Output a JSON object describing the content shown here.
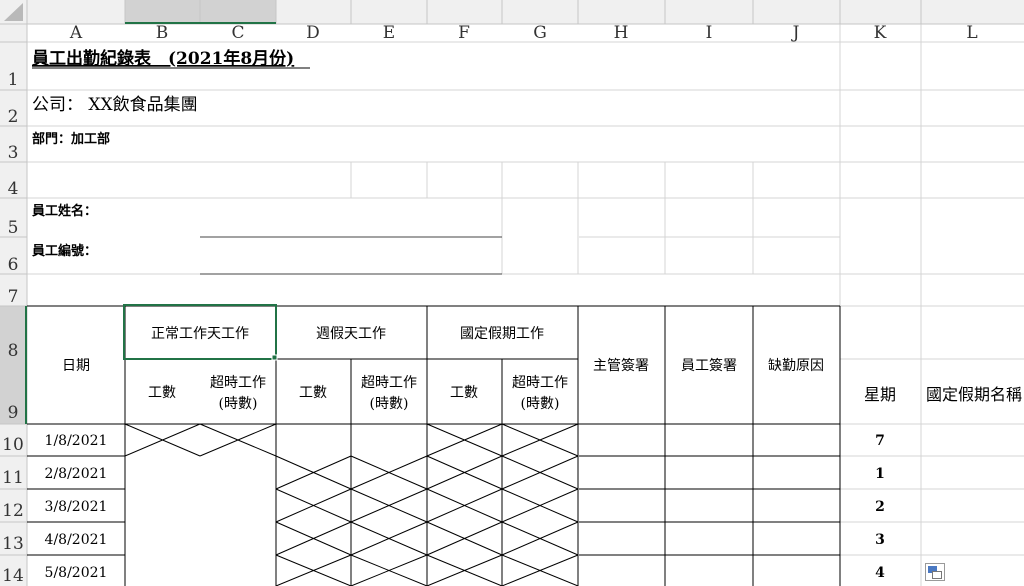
{
  "columns": [
    "A",
    "B",
    "C",
    "D",
    "E",
    "F",
    "G",
    "H",
    "I",
    "J",
    "K",
    "L"
  ],
  "rows": [
    "1",
    "2",
    "3",
    "4",
    "5",
    "6",
    "7",
    "8",
    "9",
    "10",
    "11",
    "12",
    "13",
    "14"
  ],
  "title": "員工出勤紀錄表　(2021年8月份)",
  "company": "公司： XX飲食品集團",
  "department": "部門：加工部",
  "employee_name_label": "員工姓名：",
  "employee_id_label": "員工編號：",
  "headers": {
    "date": "日期",
    "normal_work": "正常工作天工作",
    "weekend_work": "週假天工作",
    "holiday_work": "國定假期工作",
    "supervisor_sign": "主管簽署",
    "employee_sign": "員工簽署",
    "absence_reason": "缺勤原因",
    "work_count": "工數",
    "overtime_l1": "超時工作",
    "overtime_l2": "(時數)",
    "weekday": "星期",
    "holiday_name": "國定假期名稱"
  },
  "entries": [
    {
      "date": "1/8/2021",
      "weekday": "7"
    },
    {
      "date": "2/8/2021",
      "weekday": "1"
    },
    {
      "date": "3/8/2021",
      "weekday": "2"
    },
    {
      "date": "4/8/2021",
      "weekday": "3"
    },
    {
      "date": "5/8/2021",
      "weekday": "4"
    }
  ],
  "icons": {
    "paste_options": "paste-options-icon",
    "select_all": "select-all-triangle-icon"
  },
  "colors": {
    "header_bg": "#f0f0f0",
    "selected_header_bg": "#d2d2d2",
    "selection_border": "#217346",
    "gridline": "#d4d4d4"
  }
}
